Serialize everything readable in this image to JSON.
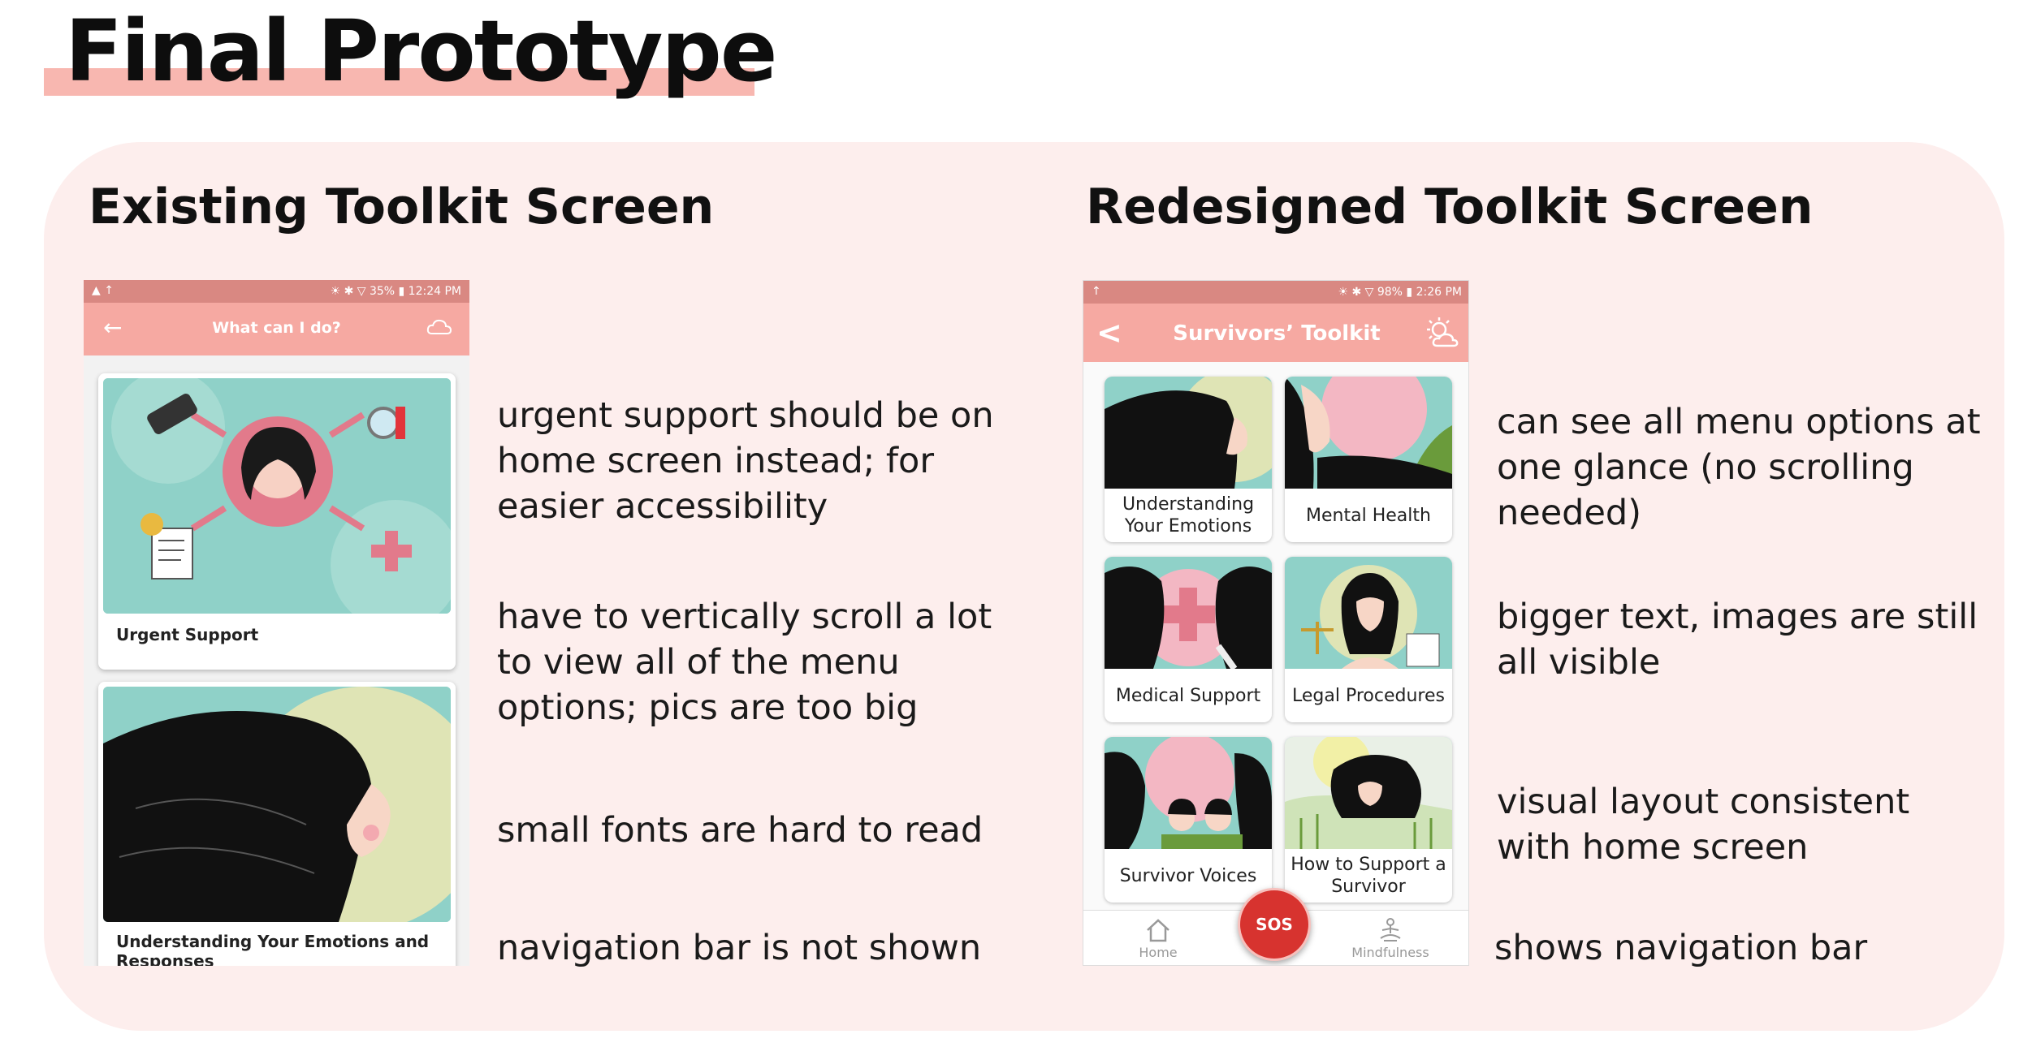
{
  "page": {
    "title": "Final Prototype"
  },
  "existing": {
    "heading": "Existing Toolkit Screen",
    "statusbar": {
      "left": "▲ ↑",
      "right": "☀ ✱ ▽ 35% ▮ 12:24 PM"
    },
    "appbar": {
      "back": "←",
      "title": "What can I do?"
    },
    "cards": [
      {
        "label": "Urgent Support"
      },
      {
        "label": "Understanding Your Emotions and Responses"
      }
    ],
    "notes": [
      "urgent support should be on home screen instead; for easier accessibility",
      "have to vertically scroll a lot to view all of the menu options; pics are too big",
      "small fonts are hard to read",
      "navigation bar is not shown"
    ]
  },
  "redesigned": {
    "heading": "Redesigned Toolkit Screen",
    "statusbar": {
      "left": "↑",
      "right": "☀ ✱ ▽ 98% ▮ 2:26 PM"
    },
    "appbar": {
      "back": "<",
      "title": "Survivors’ Toolkit"
    },
    "tiles": [
      {
        "label": "Understanding Your Emotions"
      },
      {
        "label": "Mental Health"
      },
      {
        "label": "Medical Support"
      },
      {
        "label": "Legal Procedures"
      },
      {
        "label": "Survivor Voices"
      },
      {
        "label": "How to Support a Survivor"
      }
    ],
    "nav": {
      "home": "Home",
      "sos": "SOS",
      "mindfulness": "Mindfulness"
    },
    "notes": [
      "can see all menu options at one glance (no scrolling needed)",
      "bigger text, images are still all visible",
      "visual layout consistent with home screen",
      "shows navigation bar"
    ]
  },
  "colors": {
    "accent": "#f6a9a2",
    "panel": "#fdeeed",
    "title_highlight": "#f8b7b0",
    "sos": "#d7332f",
    "teal": "#8fd1c8"
  }
}
